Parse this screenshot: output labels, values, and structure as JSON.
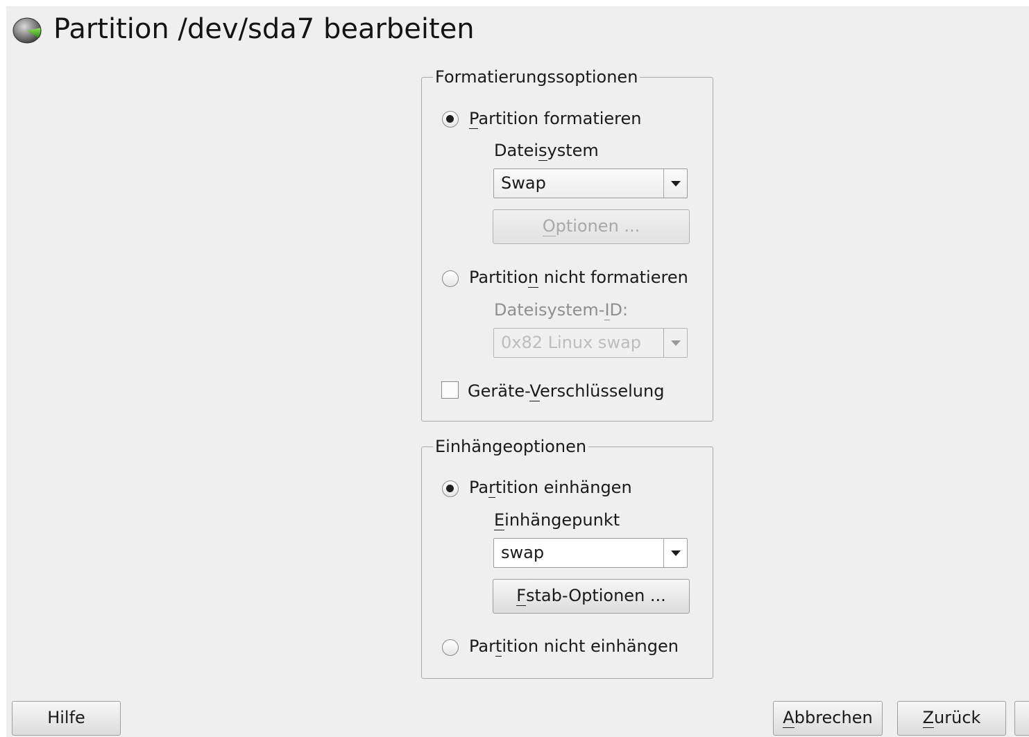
{
  "window": {
    "title": "Partition /dev/sda7 bearbeiten",
    "icon": "disk-partition-icon"
  },
  "format_group": {
    "legend": "Formatierungssoptionen",
    "format_radio": {
      "label": "Partition formatieren",
      "checked": true
    },
    "filesystem_label": "Dateisystem",
    "filesystem_value": "Swap",
    "options_button": "Optionen ...",
    "no_format_radio": {
      "label": "Partition nicht formatieren",
      "checked": false
    },
    "fsid_label": "Dateisystem-ID:",
    "fsid_value": "0x82 Linux swap",
    "encryption_checkbox": {
      "label": "Geräte-Verschlüsselung",
      "checked": false
    }
  },
  "mount_group": {
    "legend": "Einhängeoptionen",
    "mount_radio": {
      "label": "Partition einhängen",
      "checked": true
    },
    "mountpoint_label": "Einhängepunkt",
    "mountpoint_value": "swap",
    "fstab_button": "Fstab-Optionen ...",
    "no_mount_radio": {
      "label": "Partition nicht einhängen",
      "checked": false
    }
  },
  "footer": {
    "help_button": "Hilfe",
    "cancel_button": "Abbrechen",
    "back_button": "Zurück"
  },
  "colors": {
    "window_background": "#efefef",
    "icon_green": "#4caf2a"
  }
}
